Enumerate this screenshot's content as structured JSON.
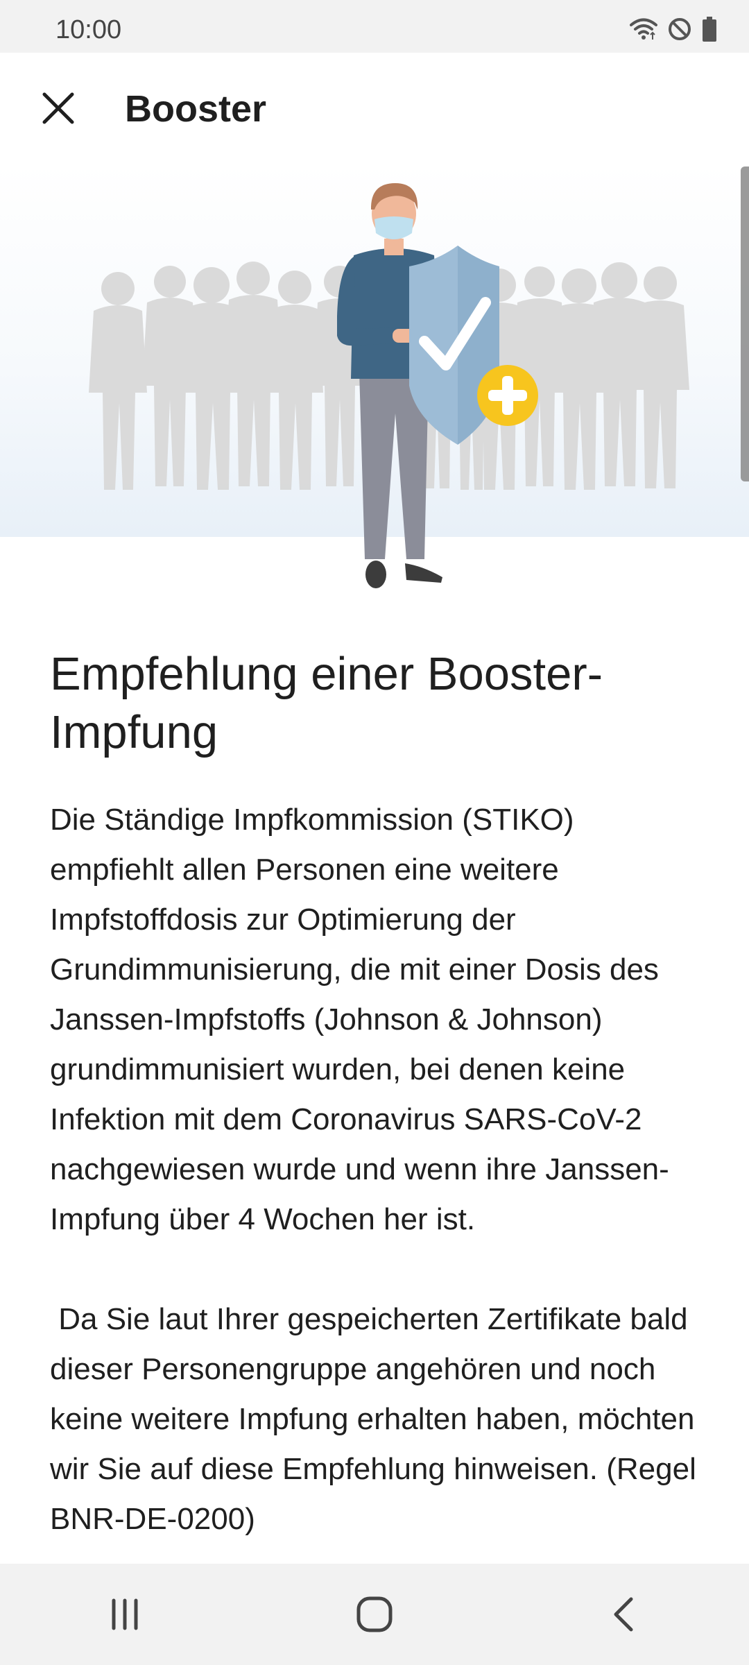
{
  "status_bar": {
    "time": "10:00",
    "icons": [
      "wifi-icon",
      "do-not-disturb-icon",
      "battery-icon"
    ]
  },
  "app_bar": {
    "title": "Booster",
    "close_icon": "close-icon"
  },
  "content": {
    "headline": "Empfehlung einer Booster-Impfung",
    "paragraph_1": "Die Ständige Impfkommission (STIKO) empfiehlt allen Personen eine weitere Impfstoffdosis zur Optimierung der Grundimmunisierung, die mit einer Dosis des Janssen-Impfstoffs (Johnson & Johnson) grundimmunisiert wurden, bei denen keine Infektion mit dem Coronavirus SARS-CoV-2 nachgewiesen wurde und wenn ihre Janssen-Impfung über 4 Wochen her ist.",
    "paragraph_2": " Da Sie laut Ihrer gespeicherten Zertifikate bald dieser Personengruppe angehören und noch keine weitere Impfung erhalten haben, möchten wir Sie auf diese Empfehlung hinweisen. (Regel BNR-DE-0200)"
  },
  "nav_bar": {
    "icons": [
      "recent-apps-icon",
      "home-icon",
      "back-icon"
    ]
  },
  "colors": {
    "status_bar_bg": "#f2f2f2",
    "text": "#1f1f1f",
    "crowd": "#d9d9d9",
    "shirt": "#3f6685",
    "pants": "#8b8d99",
    "shield": "#9dbcd6",
    "plus_badge": "#f7c51e"
  }
}
